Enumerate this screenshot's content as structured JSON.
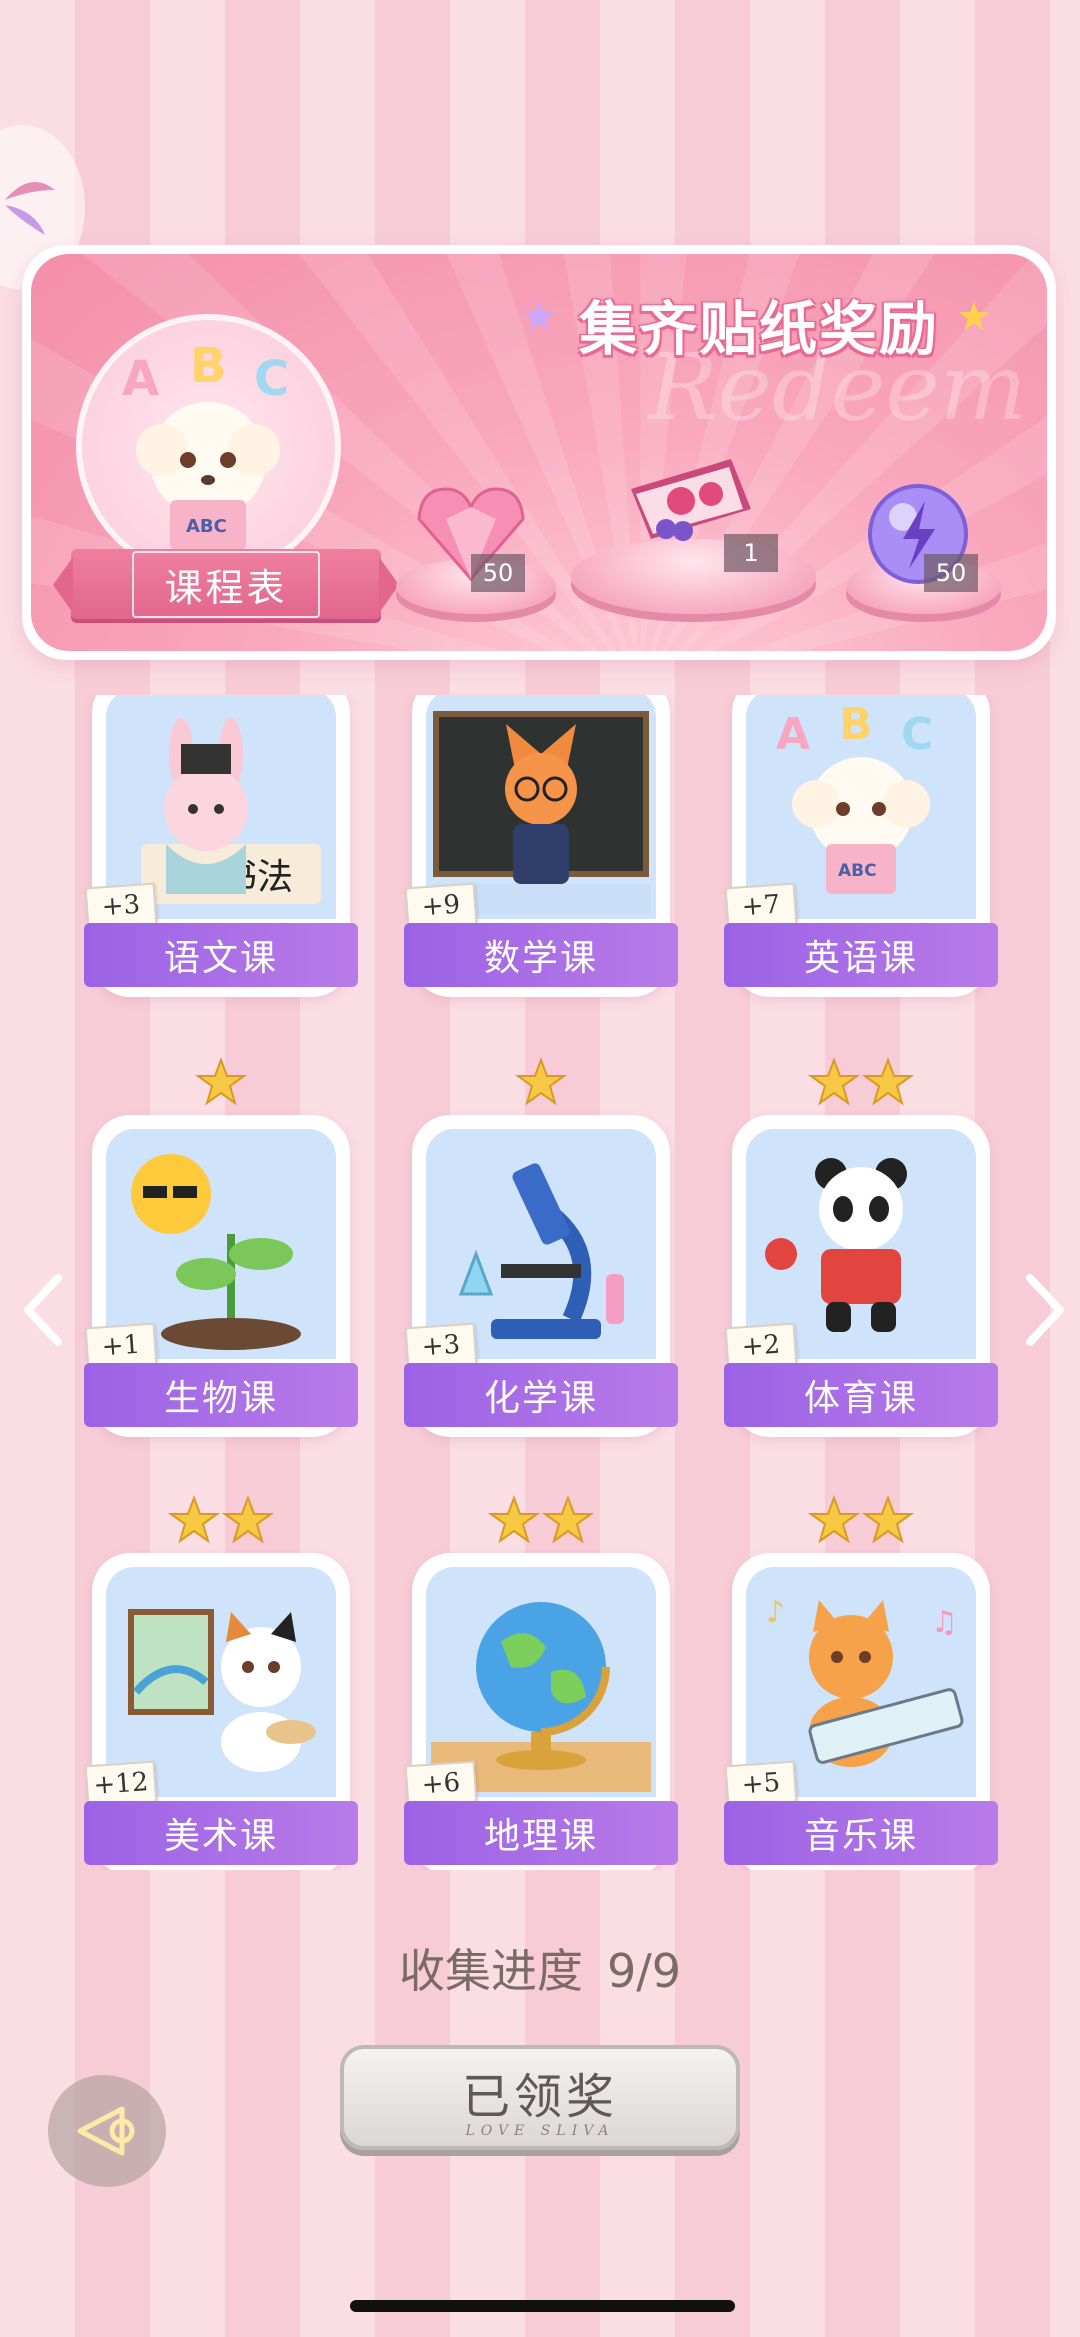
{
  "banner": {
    "title": "集齐贴纸奖励",
    "watermark": "Redeem",
    "schedule_label": "课程表",
    "rewards": [
      {
        "icon": "pink-diamond-icon",
        "count": "50"
      },
      {
        "icon": "gift-box-icon",
        "count": "1"
      },
      {
        "icon": "energy-orb-icon",
        "count": "50"
      }
    ]
  },
  "subjects": [
    {
      "label": "语文课",
      "count": "+3",
      "stars": 0,
      "icon": "bunny-calligraphy-icon"
    },
    {
      "label": "数学课",
      "count": "+9",
      "stars": 0,
      "icon": "fox-teacher-icon"
    },
    {
      "label": "英语课",
      "count": "+7",
      "stars": 0,
      "icon": "puppy-abc-icon"
    },
    {
      "label": "生物课",
      "count": "+1",
      "stars": 1,
      "icon": "sprout-sun-icon"
    },
    {
      "label": "化学课",
      "count": "+3",
      "stars": 1,
      "icon": "microscope-icon"
    },
    {
      "label": "体育课",
      "count": "+2",
      "stars": 2,
      "icon": "panda-pingpong-icon"
    },
    {
      "label": "美术课",
      "count": "+12",
      "stars": 2,
      "icon": "cat-painter-icon"
    },
    {
      "label": "地理课",
      "count": "+6",
      "stars": 2,
      "icon": "globe-icon"
    },
    {
      "label": "音乐课",
      "count": "+5",
      "stars": 2,
      "icon": "cat-keyboard-icon"
    }
  ],
  "progress": {
    "label": "收集进度",
    "value": "9/9"
  },
  "claim": {
    "label": "已领奖",
    "sub": "LOVE SLIVA"
  },
  "colors": {
    "accent": "#9c62e6",
    "banner": "#f48eab",
    "star": "#f6c843"
  }
}
